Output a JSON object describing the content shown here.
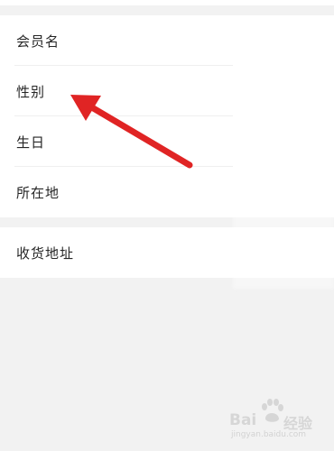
{
  "profile": {
    "rows": [
      {
        "label": "会员名"
      },
      {
        "label": "性别"
      },
      {
        "label": "生日"
      },
      {
        "label": "所在地"
      }
    ],
    "address_label": "收货地址"
  },
  "annotation": {
    "arrow_color": "#e02424",
    "target": "性别"
  },
  "watermark": {
    "brand": "Bai",
    "brand_suffix": "经验",
    "site": "jingyan.baidu.com",
    "paw_icon": "baidu-paw-icon"
  }
}
